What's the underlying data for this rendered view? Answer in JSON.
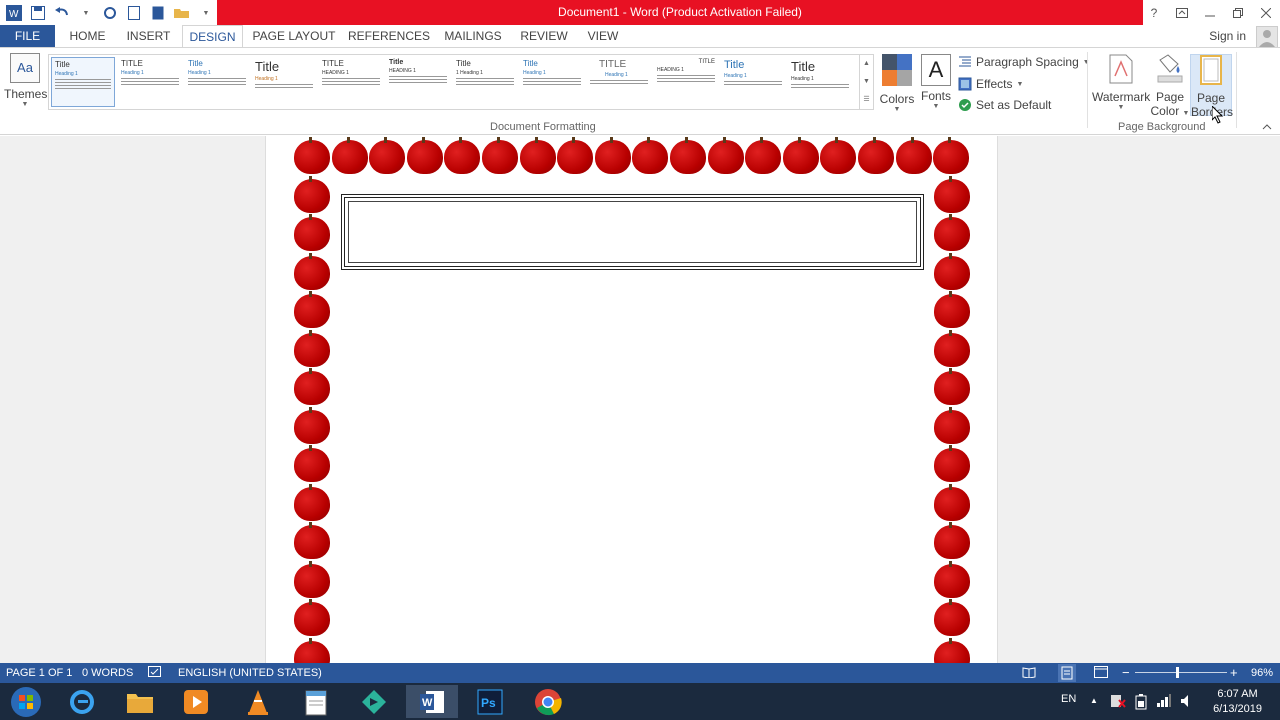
{
  "window": {
    "title": "Document1 - Word (Product Activation Failed)",
    "help": "?",
    "sign_in": "Sign in"
  },
  "tabs": [
    {
      "label": "FILE"
    },
    {
      "label": "HOME"
    },
    {
      "label": "INSERT"
    },
    {
      "label": "DESIGN"
    },
    {
      "label": "PAGE LAYOUT"
    },
    {
      "label": "REFERENCES"
    },
    {
      "label": "MAILINGS"
    },
    {
      "label": "REVIEW"
    },
    {
      "label": "VIEW"
    }
  ],
  "ribbon": {
    "themes_label": "Themes",
    "themes_icon_text": "Aa",
    "gallery": [
      {
        "title": "Title",
        "heading": "Heading 1"
      },
      {
        "title": "TITLE",
        "heading": "Heading 1"
      },
      {
        "title": "Title",
        "heading": "Heading 1"
      },
      {
        "title": "Title",
        "heading": "Heading 1"
      },
      {
        "title": "TITLE",
        "heading": "HEADING 1"
      },
      {
        "title": "Title",
        "heading": "HEADING 1"
      },
      {
        "title": "Title",
        "heading": "1 Heading 1"
      },
      {
        "title": "Title",
        "heading": "Heading 1"
      },
      {
        "title": "TITLE",
        "heading": "Heading 1"
      },
      {
        "title": "TITLE",
        "heading": "HEADING 1"
      },
      {
        "title": "Title",
        "heading": "Heading 1"
      },
      {
        "title": "Title",
        "heading": "Heading 1"
      }
    ],
    "colors_label": "Colors",
    "fonts_label": "Fonts",
    "fonts_icon_text": "A",
    "paragraph_spacing_label": "Paragraph Spacing",
    "effects_label": "Effects",
    "set_default_label": "Set as Default",
    "group_document_formatting": "Document Formatting",
    "watermark_label": "Watermark",
    "page_color_label_1": "Page",
    "page_color_label_2": "Color",
    "page_borders_label_1": "Page",
    "page_borders_label_2": "Borders",
    "group_page_background": "Page Background"
  },
  "statusbar": {
    "page": "PAGE 1 OF 1",
    "words": "0 WORDS",
    "language": "ENGLISH (UNITED STATES)",
    "zoom": "96%"
  },
  "taskbar": {
    "lang": "EN",
    "time": "6:07 AM",
    "date": "6/13/2019"
  },
  "colors": {
    "title_bar_red": "#e81123",
    "accent_blue": "#2b579a",
    "apple_red": "#c00000"
  }
}
